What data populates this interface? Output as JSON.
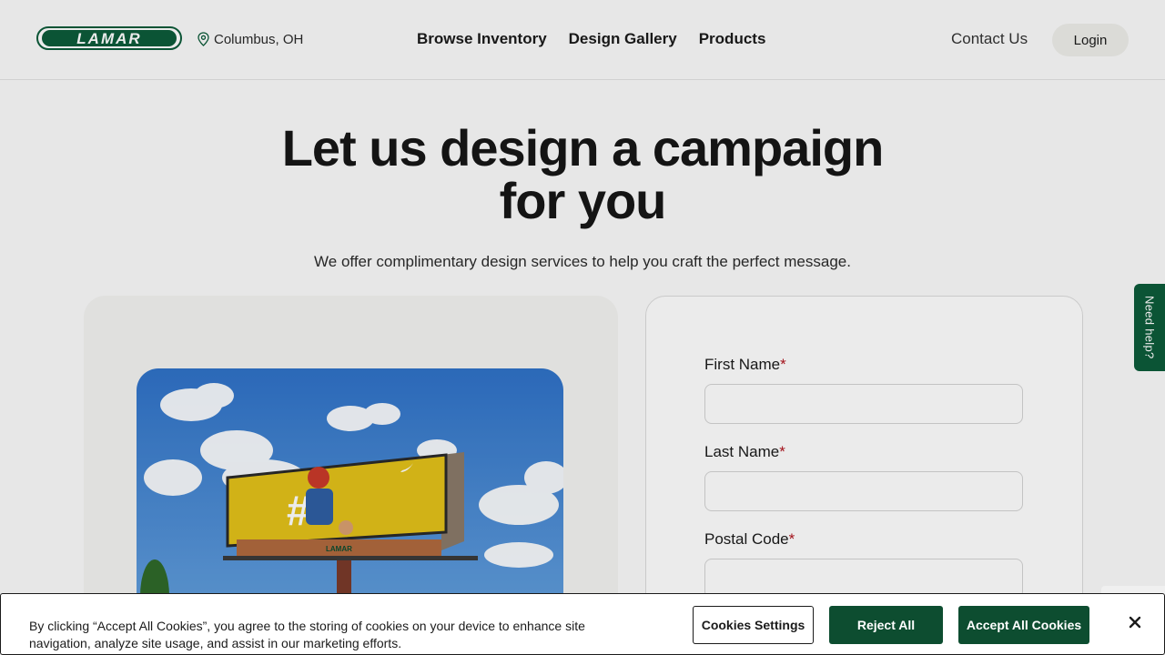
{
  "header": {
    "logo_text": "LAMAR",
    "location": "Columbus, OH",
    "nav": [
      "Browse Inventory",
      "Design Gallery",
      "Products"
    ],
    "contact_label": "Contact Us",
    "login_label": "Login"
  },
  "hero": {
    "title_line1": "Let us design a campaign",
    "title_line2": "for you",
    "subtitle": "We offer complimentary design services to help you craft the perfect message."
  },
  "form": {
    "fields": [
      {
        "label": "First Name",
        "required_mark": "*",
        "value": ""
      },
      {
        "label": "Last Name",
        "required_mark": "*",
        "value": ""
      },
      {
        "label": "Postal Code",
        "required_mark": "*",
        "value": ""
      }
    ]
  },
  "need_help": "Need help?",
  "cookie_banner": {
    "text": "By clicking “Accept All Cookies”, you agree to the storing of cookies on your device to enhance site navigation, analyze site usage, and assist in our marketing efforts.",
    "settings_label": "Cookies Settings",
    "reject_label": "Reject All",
    "accept_label": "Accept All Cookies"
  },
  "billboard": {
    "symbol": "#",
    "brand": "LAMAR"
  },
  "icons": {
    "location": "map-pin-icon",
    "close": "close-icon",
    "bird": "twitter-bird-icon"
  },
  "colors": {
    "brand_green": "#0d4d30",
    "required_red": "#b1141e",
    "billboard_yellow": "#e3c21a"
  }
}
